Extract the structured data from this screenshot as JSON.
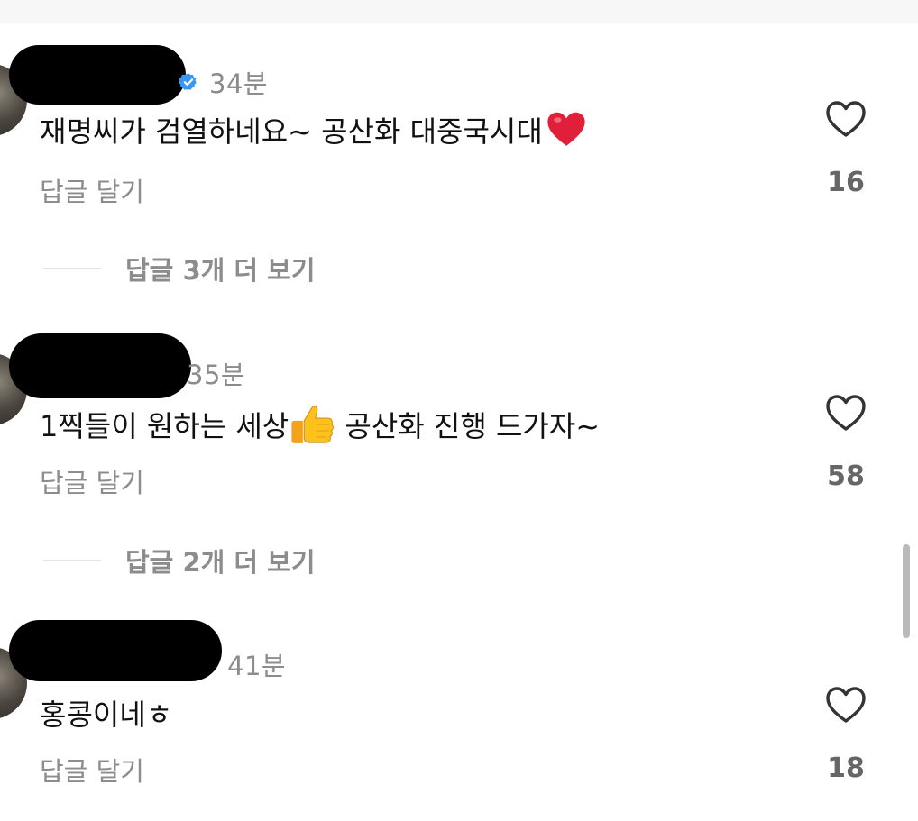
{
  "comments": [
    {
      "time": "34분",
      "text": "재명씨가 검열하네요~ 공산화 대중국시대",
      "emoji": "heart-emoji",
      "reply_label": "답글 달기",
      "likes": "16",
      "more_replies": "답글 3개 더 보기"
    },
    {
      "time": "35분",
      "text": "1찍들이 원하는 세상",
      "emoji": "thumbs-up-emoji",
      "text_after": " 공산화 진행 드가자~",
      "reply_label": "답글 달기",
      "likes": "58",
      "more_replies": "답글 2개 더 보기"
    },
    {
      "time": "41분",
      "text": "홍콩이네ㅎ",
      "reply_label": "답글 달기",
      "likes": "18"
    }
  ],
  "colors": {
    "verified": "#3897f0",
    "heart_emoji": "#e0203a",
    "like_icon": "#333333",
    "muted_text": "#8c8c8c"
  },
  "icons": {
    "like": "heart-outline-icon",
    "verified": "verified-badge-icon"
  }
}
